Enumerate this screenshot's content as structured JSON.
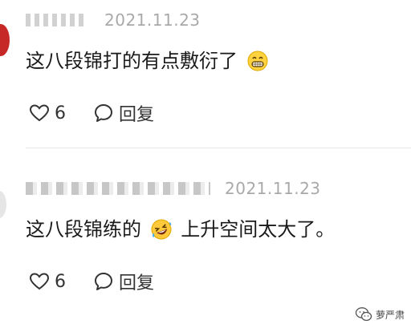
{
  "comments": [
    {
      "date": "2021.11.23",
      "text": "这八段锦打的有点敷衍了",
      "emoji": "grinning-face-emoji",
      "likes": "6",
      "reply_label": "回复"
    },
    {
      "date": "2021.11.23",
      "text_before": "这八段锦练的",
      "emoji": "rolling-on-floor-laughing-emoji",
      "text_after": "上升空间太大了。",
      "likes": "6",
      "reply_label": "回复"
    }
  ],
  "watermark": {
    "text": "萝严肃",
    "icon": "wechat-icon"
  },
  "colors": {
    "date": "#a9a9a9",
    "text": "#1a1a1a",
    "divider": "#e8e8e8"
  }
}
